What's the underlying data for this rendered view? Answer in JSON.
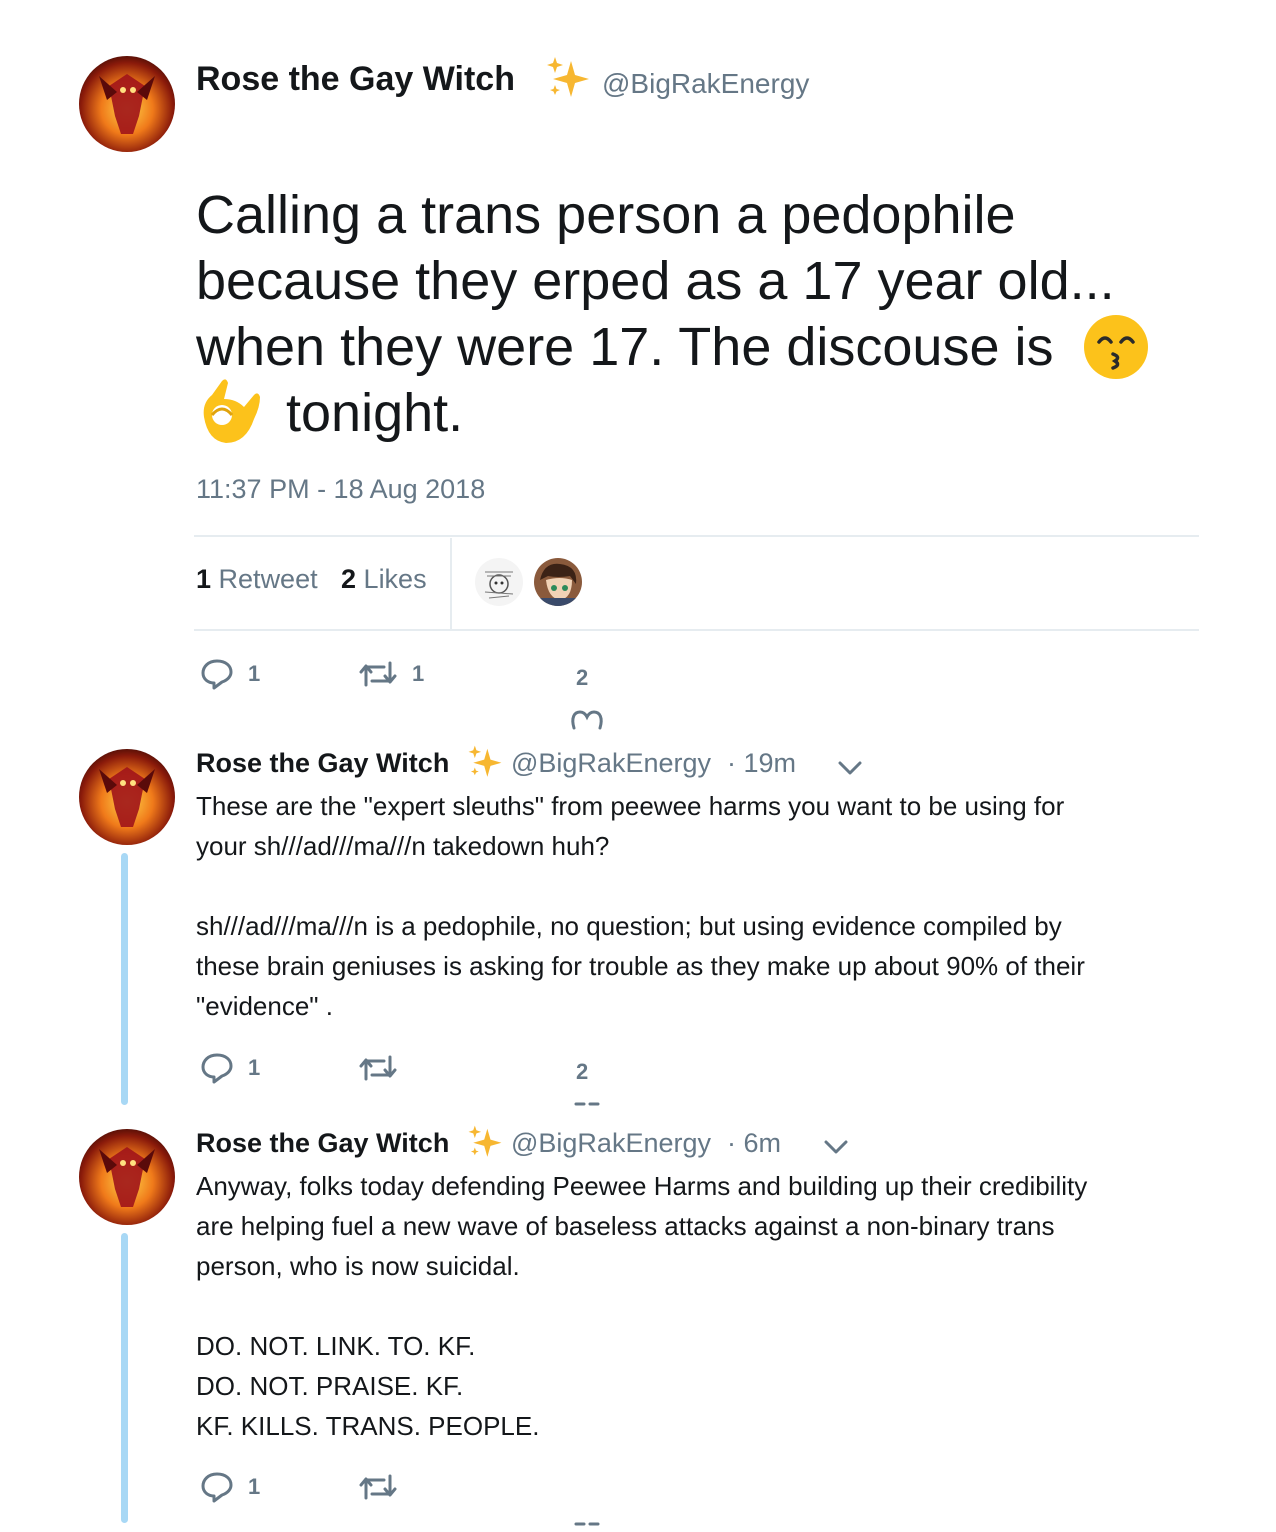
{
  "main_tweet": {
    "author_name": "Rose the Gay Witch",
    "handle": "@BigRakEnergy",
    "text_line1": "Calling a trans person a pedophile",
    "text_line2": "because they erped as a 17 year old...",
    "text_line3": "when they were 17. The discouse is",
    "text_line4": "tonight.",
    "timestamp": "11:37 PM - 18 Aug 2018",
    "retweet_count": "1",
    "retweet_label": "Retweet",
    "like_count": "2",
    "like_label": "Likes",
    "reply_count": "1",
    "retweet_action_count": "1",
    "like_action_count": "2"
  },
  "replies": [
    {
      "author_name": "Rose the Gay Witch",
      "handle": "@BigRakEnergy",
      "time": "· 19m",
      "text": "These are the \"expert sleuths\" from peewee harms you want to be using for\nyour sh///ad///ma///n takedown huh?\n\nsh///ad///ma///n is a pedophile, no question; but using evidence compiled by\nthese brain geniuses is asking for trouble as they make up about 90% of their\n\"evidence\" .",
      "reply_count": "1",
      "like_count": "2"
    },
    {
      "author_name": "Rose the Gay Witch",
      "handle": "@BigRakEnergy",
      "time": "· 6m",
      "text": "Anyway, folks today defending Peewee Harms and building up their credibility\nare helping fuel a new wave of baseless attacks against a non-binary trans\nperson, who is now suicidal.\n\nDO. NOT. LINK. TO. KF.\nDO. NOT. PRAISE. KF.\nKF. KILLS. TRANS. PEOPLE.",
      "reply_count": "1"
    }
  ],
  "colors": {
    "text": "#14171a",
    "secondary": "#657786",
    "thread_line": "#a8d8f5",
    "divider": "#e6ecf0"
  }
}
